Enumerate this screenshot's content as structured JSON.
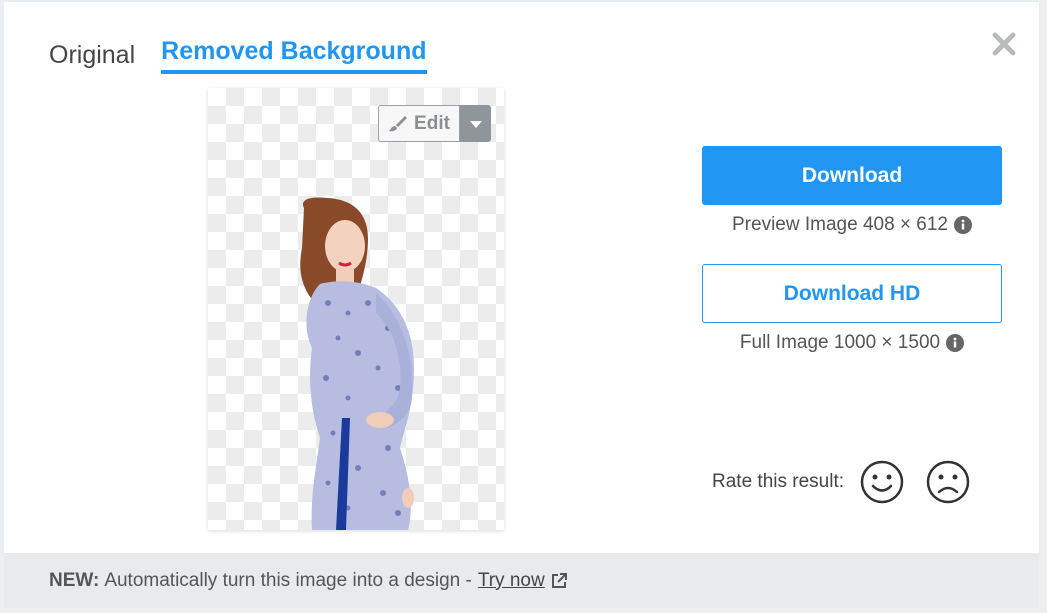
{
  "tabs": [
    {
      "label": "Original"
    },
    {
      "label": "Removed Background"
    }
  ],
  "preview": {
    "edit_label": "Edit"
  },
  "actions": {
    "download_label": "Download",
    "download_hd_label": "Download HD",
    "preview_info": "Preview Image 408 × 612",
    "full_info": "Full Image 1000 × 1500"
  },
  "rating": {
    "label": "Rate this result:"
  },
  "footer": {
    "new_label": "NEW:",
    "text": "Automatically turn this image into a design -",
    "link": "Try now"
  },
  "colors": {
    "accent": "#2196f3",
    "footer_bg": "#e8ebee"
  }
}
